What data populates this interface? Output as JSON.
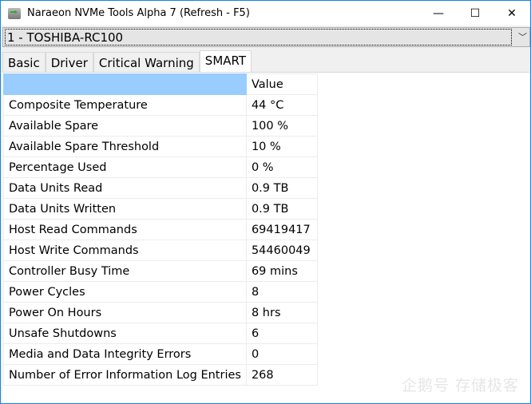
{
  "window": {
    "title": "Naraeon NVMe Tools Alpha 7 (Refresh - F5)",
    "minimize": "—",
    "maximize": "☐",
    "close": "✕"
  },
  "device_select": {
    "value": "1 - TOSHIBA-RC100",
    "arrow": "﹀"
  },
  "tabs": [
    {
      "label": "Basic"
    },
    {
      "label": "Driver"
    },
    {
      "label": "Critical Warning"
    },
    {
      "label": "SMART"
    }
  ],
  "table": {
    "headers": [
      "",
      "Value"
    ],
    "rows": [
      {
        "name": "Composite Temperature",
        "value": "44 °C"
      },
      {
        "name": "Available Spare",
        "value": "100 %"
      },
      {
        "name": "Available Spare Threshold",
        "value": "10 %"
      },
      {
        "name": "Percentage Used",
        "value": "0 %"
      },
      {
        "name": "Data Units Read",
        "value": "0.9 TB"
      },
      {
        "name": "Data Units Written",
        "value": "0.9 TB"
      },
      {
        "name": "Host Read Commands",
        "value": "69419417"
      },
      {
        "name": "Host Write Commands",
        "value": "54460049"
      },
      {
        "name": "Controller Busy Time",
        "value": "69 mins"
      },
      {
        "name": "Power Cycles",
        "value": "8"
      },
      {
        "name": "Power On Hours",
        "value": "8 hrs"
      },
      {
        "name": "Unsafe Shutdowns",
        "value": "6"
      },
      {
        "name": "Media and Data Integrity Errors",
        "value": "0"
      },
      {
        "name": "Number of Error Information Log Entries",
        "value": "268"
      }
    ]
  },
  "watermark": "企鹅号 存储极客"
}
